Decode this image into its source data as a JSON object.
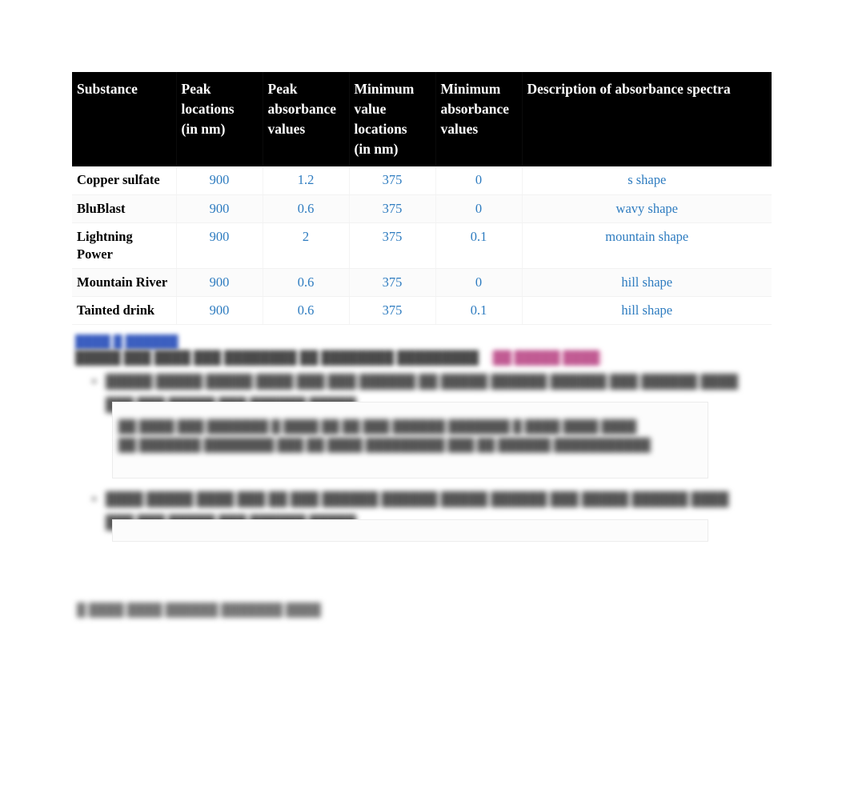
{
  "document": {
    "table": {
      "columns": [
        "Substance",
        "Peak locations (in nm)",
        "Peak absorbance values",
        "Minimum value locations (in nm)",
        "Minimum absorbance values",
        "Description of absorbance spectra"
      ],
      "header_lines": {
        "c0": [
          "Substance"
        ],
        "c1": [
          "Peak",
          "locations",
          "(in nm)"
        ],
        "c2": [
          "Peak",
          "absorbance",
          "values"
        ],
        "c3": [
          "Minimum",
          "value",
          "locations",
          "(in nm)"
        ],
        "c4": [
          "Minimum",
          "absorbance",
          "values"
        ],
        "c5": [
          "Description of absorbance spectra"
        ]
      },
      "rows": [
        {
          "substance": "Copper sulfate",
          "peak_location_nm": "900",
          "peak_absorbance": "1.2",
          "min_location_nm": "375",
          "min_absorbance": "0",
          "description": "s shape"
        },
        {
          "substance": "BluBlast",
          "peak_location_nm": "900",
          "peak_absorbance": "0.6",
          "min_location_nm": "375",
          "min_absorbance": "0",
          "description": "wavy shape"
        },
        {
          "substance": "Lightning Power",
          "peak_location_nm": "900",
          "peak_absorbance": "2",
          "min_location_nm": "375",
          "min_absorbance": "0.1",
          "description": "mountain shape"
        },
        {
          "substance": "Mountain River",
          "peak_location_nm": "900",
          "peak_absorbance": "0.6",
          "min_location_nm": "375",
          "min_absorbance": "0",
          "description": "hill shape"
        },
        {
          "substance": "Tainted drink",
          "peak_location_nm": "900",
          "peak_absorbance": "0.6",
          "min_location_nm": "375",
          "min_absorbance": "0.1",
          "description": "hill shape"
        }
      ]
    },
    "obscured": {
      "heading_link": "████ █ ██████",
      "intro_text": "█████ ███ ████ ███ ████████ ██ ████████ █████████",
      "intro_highlight": "██ █████ ████",
      "question_1": "█████ █████ █████ ████ ███ ███ ██████ ██ █████ ██████ ██████ ███ ██████ ████ ███ ███ █████ ███ ██████ █████",
      "answer_1_line_1": "██ ████ ███ ███████ █ ████ ██ ██ ███ ██████ ███████ █ ████ ████ ████",
      "answer_1_line_2": "██ ███████ ████████ ███ ██ ████ █████████ ███ ██ ██████ ███████████",
      "question_2": "████ █████ ████ ███ ██ ███ ██████ ██████ █████ ██████ ███ █████ ██████ ████ ███ ███ █████ ███ ██████ █████",
      "footer_text": "█ ████ ████ ██████ ███████ ████"
    },
    "colors": {
      "header_bg": "#000000",
      "header_text": "#ffffff",
      "data_value_blue": "#2e7cc0",
      "substance_text": "#000000",
      "link_blue": "#3b5ec0",
      "highlight_pink": "#fbe4ef",
      "page_bg": "#ffffff"
    }
  }
}
